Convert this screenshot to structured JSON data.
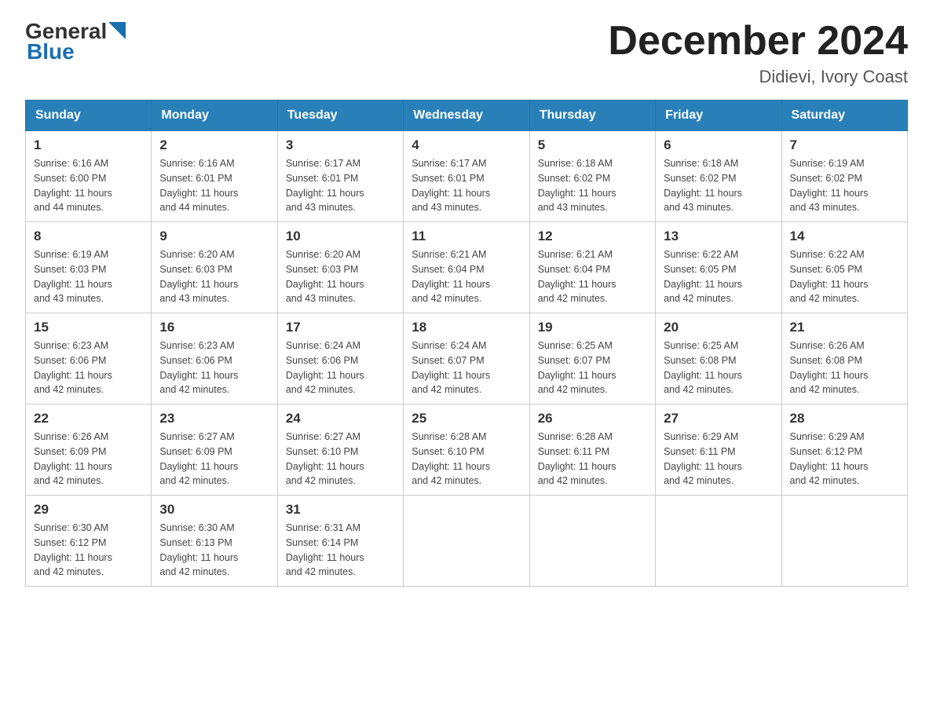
{
  "logo": {
    "general": "General",
    "blue": "Blue",
    "triangle_color": "#1a6faf"
  },
  "header": {
    "title": "December 2024",
    "subtitle": "Didievi, Ivory Coast"
  },
  "days_of_week": [
    "Sunday",
    "Monday",
    "Tuesday",
    "Wednesday",
    "Thursday",
    "Friday",
    "Saturday"
  ],
  "weeks": [
    [
      {
        "number": "1",
        "sunrise": "6:16 AM",
        "sunset": "6:00 PM",
        "daylight": "11 hours and 44 minutes."
      },
      {
        "number": "2",
        "sunrise": "6:16 AM",
        "sunset": "6:01 PM",
        "daylight": "11 hours and 44 minutes."
      },
      {
        "number": "3",
        "sunrise": "6:17 AM",
        "sunset": "6:01 PM",
        "daylight": "11 hours and 43 minutes."
      },
      {
        "number": "4",
        "sunrise": "6:17 AM",
        "sunset": "6:01 PM",
        "daylight": "11 hours and 43 minutes."
      },
      {
        "number": "5",
        "sunrise": "6:18 AM",
        "sunset": "6:02 PM",
        "daylight": "11 hours and 43 minutes."
      },
      {
        "number": "6",
        "sunrise": "6:18 AM",
        "sunset": "6:02 PM",
        "daylight": "11 hours and 43 minutes."
      },
      {
        "number": "7",
        "sunrise": "6:19 AM",
        "sunset": "6:02 PM",
        "daylight": "11 hours and 43 minutes."
      }
    ],
    [
      {
        "number": "8",
        "sunrise": "6:19 AM",
        "sunset": "6:03 PM",
        "daylight": "11 hours and 43 minutes."
      },
      {
        "number": "9",
        "sunrise": "6:20 AM",
        "sunset": "6:03 PM",
        "daylight": "11 hours and 43 minutes."
      },
      {
        "number": "10",
        "sunrise": "6:20 AM",
        "sunset": "6:03 PM",
        "daylight": "11 hours and 43 minutes."
      },
      {
        "number": "11",
        "sunrise": "6:21 AM",
        "sunset": "6:04 PM",
        "daylight": "11 hours and 42 minutes."
      },
      {
        "number": "12",
        "sunrise": "6:21 AM",
        "sunset": "6:04 PM",
        "daylight": "11 hours and 42 minutes."
      },
      {
        "number": "13",
        "sunrise": "6:22 AM",
        "sunset": "6:05 PM",
        "daylight": "11 hours and 42 minutes."
      },
      {
        "number": "14",
        "sunrise": "6:22 AM",
        "sunset": "6:05 PM",
        "daylight": "11 hours and 42 minutes."
      }
    ],
    [
      {
        "number": "15",
        "sunrise": "6:23 AM",
        "sunset": "6:06 PM",
        "daylight": "11 hours and 42 minutes."
      },
      {
        "number": "16",
        "sunrise": "6:23 AM",
        "sunset": "6:06 PM",
        "daylight": "11 hours and 42 minutes."
      },
      {
        "number": "17",
        "sunrise": "6:24 AM",
        "sunset": "6:06 PM",
        "daylight": "11 hours and 42 minutes."
      },
      {
        "number": "18",
        "sunrise": "6:24 AM",
        "sunset": "6:07 PM",
        "daylight": "11 hours and 42 minutes."
      },
      {
        "number": "19",
        "sunrise": "6:25 AM",
        "sunset": "6:07 PM",
        "daylight": "11 hours and 42 minutes."
      },
      {
        "number": "20",
        "sunrise": "6:25 AM",
        "sunset": "6:08 PM",
        "daylight": "11 hours and 42 minutes."
      },
      {
        "number": "21",
        "sunrise": "6:26 AM",
        "sunset": "6:08 PM",
        "daylight": "11 hours and 42 minutes."
      }
    ],
    [
      {
        "number": "22",
        "sunrise": "6:26 AM",
        "sunset": "6:09 PM",
        "daylight": "11 hours and 42 minutes."
      },
      {
        "number": "23",
        "sunrise": "6:27 AM",
        "sunset": "6:09 PM",
        "daylight": "11 hours and 42 minutes."
      },
      {
        "number": "24",
        "sunrise": "6:27 AM",
        "sunset": "6:10 PM",
        "daylight": "11 hours and 42 minutes."
      },
      {
        "number": "25",
        "sunrise": "6:28 AM",
        "sunset": "6:10 PM",
        "daylight": "11 hours and 42 minutes."
      },
      {
        "number": "26",
        "sunrise": "6:28 AM",
        "sunset": "6:11 PM",
        "daylight": "11 hours and 42 minutes."
      },
      {
        "number": "27",
        "sunrise": "6:29 AM",
        "sunset": "6:11 PM",
        "daylight": "11 hours and 42 minutes."
      },
      {
        "number": "28",
        "sunrise": "6:29 AM",
        "sunset": "6:12 PM",
        "daylight": "11 hours and 42 minutes."
      }
    ],
    [
      {
        "number": "29",
        "sunrise": "6:30 AM",
        "sunset": "6:12 PM",
        "daylight": "11 hours and 42 minutes."
      },
      {
        "number": "30",
        "sunrise": "6:30 AM",
        "sunset": "6:13 PM",
        "daylight": "11 hours and 42 minutes."
      },
      {
        "number": "31",
        "sunrise": "6:31 AM",
        "sunset": "6:14 PM",
        "daylight": "11 hours and 42 minutes."
      },
      null,
      null,
      null,
      null
    ]
  ],
  "labels": {
    "sunrise": "Sunrise:",
    "sunset": "Sunset:",
    "daylight": "Daylight:"
  }
}
